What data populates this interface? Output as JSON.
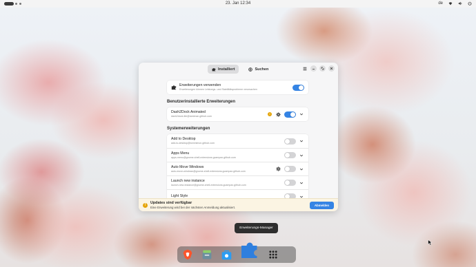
{
  "topbar": {
    "clock": "23. Jan  12:34",
    "keyboard_layout": "de"
  },
  "window": {
    "tabs": [
      {
        "label": "Installiert",
        "icon": "puzzle-icon",
        "active": true
      },
      {
        "label": "Suchen",
        "icon": "globe-icon",
        "active": false
      }
    ],
    "use_extensions": {
      "title": "Erweiterungen verwenden",
      "subtitle": "Erweiterungen können Leistungs- und Stabilitätsprobleme verursachen",
      "enabled": true
    },
    "user_section_title": "Benutzerinstallierte Erweiterungen",
    "user_extensions": [
      {
        "name": "Dash2Dock Animated",
        "id": "dash2dock-lite@icedman.github.com",
        "enabled": true,
        "has_settings": true,
        "has_warning": true
      }
    ],
    "system_section_title": "Systemerweiterungen",
    "system_extensions": [
      {
        "name": "Add to Desktop",
        "id": "add-to-desktop@tommimon.github.com",
        "enabled": false,
        "has_settings": false
      },
      {
        "name": "Apps Menu",
        "id": "apps-menu@gnome-shell-extensions.gcampax.github.com",
        "enabled": false,
        "has_settings": false
      },
      {
        "name": "Auto Move Windows",
        "id": "auto-move-windows@gnome-shell-extensions.gcampax.github.com",
        "enabled": false,
        "has_settings": true
      },
      {
        "name": "Launch new instance",
        "id": "launch-new-instance@gnome-shell-extensions.gcampax.github.com",
        "enabled": false,
        "has_settings": false
      },
      {
        "name": "Light Style",
        "id": "",
        "enabled": false,
        "has_settings": false
      }
    ],
    "banner": {
      "title": "Updates sind verfügbar",
      "subtitle": "Eine Erweiterung wird bei der nächsten Anmeldung aktualisiert.",
      "button_label": "Abmelden"
    }
  },
  "tooltip": "Erweiterungs-Manager",
  "dock": {
    "items": [
      "brave-browser-icon",
      "files-icon",
      "software-store-icon",
      "extension-manager-icon",
      "app-grid-icon"
    ]
  },
  "colors": {
    "accent": "#3584e4",
    "warning": "#e5a50a"
  }
}
